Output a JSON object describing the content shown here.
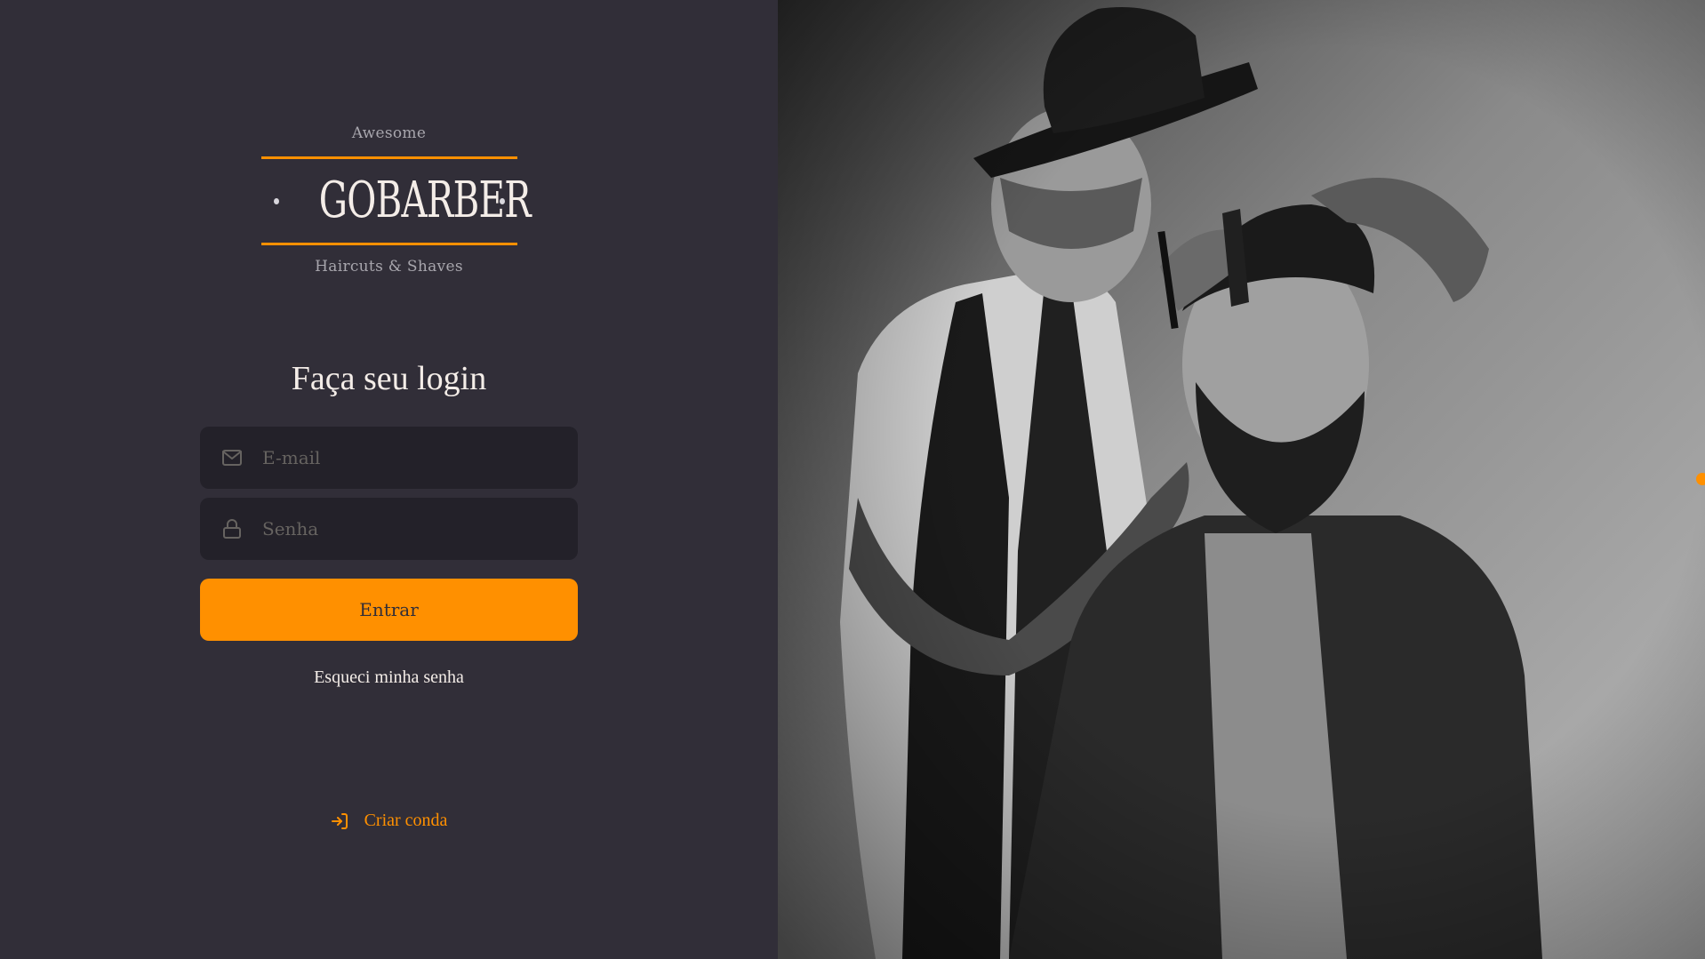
{
  "logo": {
    "top_text": "Awesome",
    "name": "GOBARBER",
    "bottom_text": "Haircuts & Shaves"
  },
  "form": {
    "title": "Faça seu login",
    "email_placeholder": "E-mail",
    "password_placeholder": "Senha",
    "submit_label": "Entrar",
    "forgot_label": "Esqueci minha senha"
  },
  "create_account": {
    "label": "Criar conda",
    "icon": "log-in-icon"
  },
  "icons": {
    "email": "mail-icon",
    "password": "lock-icon"
  },
  "colors": {
    "background": "#312e38",
    "input_background": "#232129",
    "accent": "#ff9000",
    "text": "#f4ede8",
    "placeholder": "#666360"
  },
  "image": {
    "description_icon": "barber-photo"
  }
}
